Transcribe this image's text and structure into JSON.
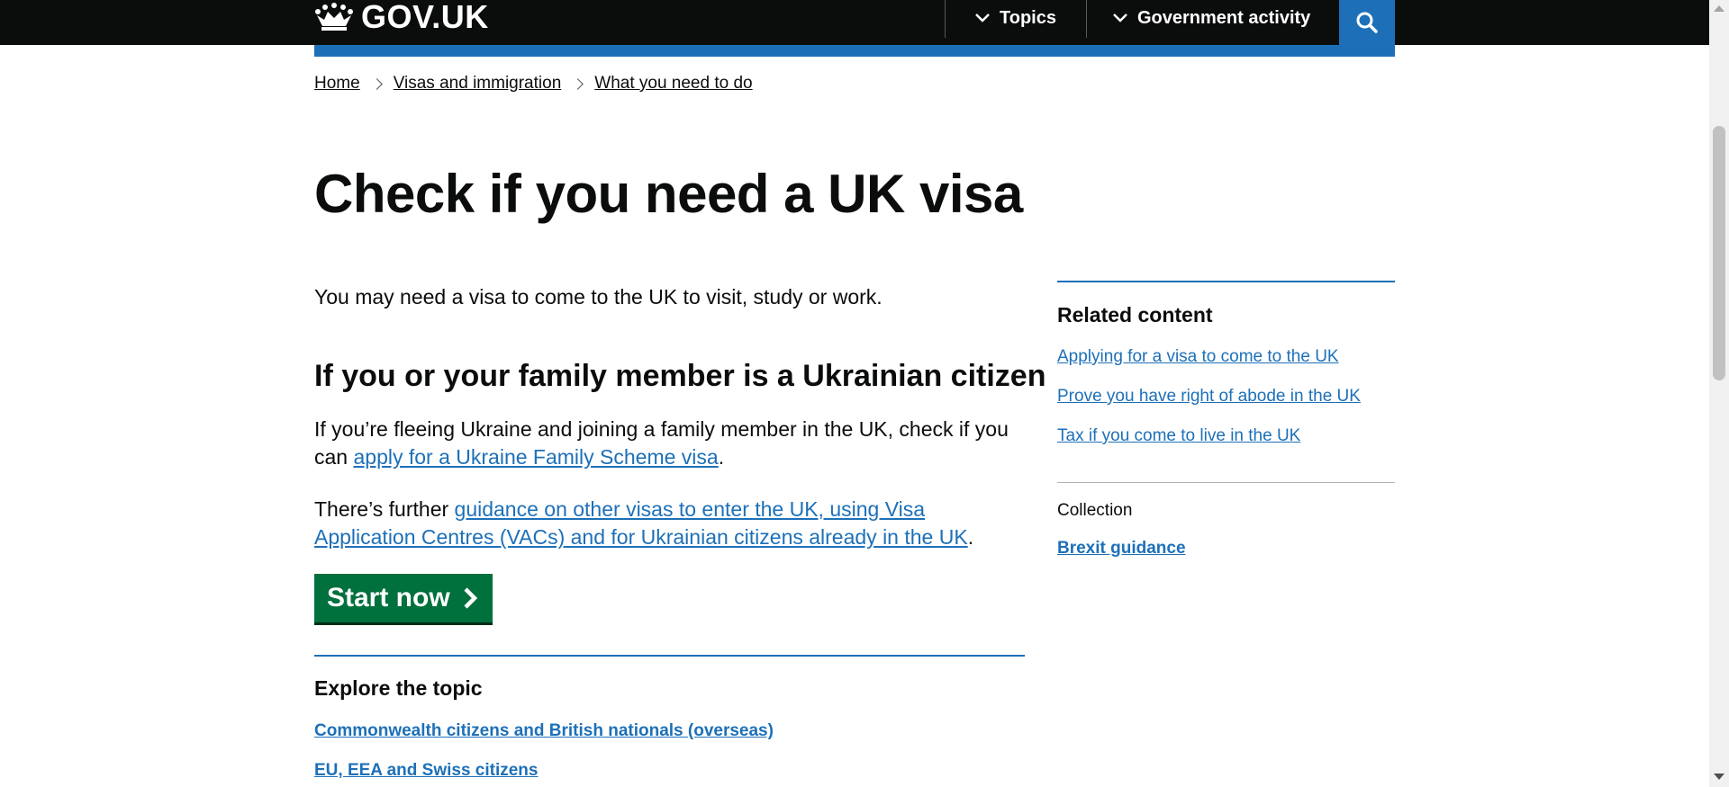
{
  "header": {
    "logo_text": "GOV.UK",
    "logo_icon": "crown-icon",
    "nav": [
      {
        "label": "Topics",
        "icon": "chevron-down-icon"
      },
      {
        "label": "Government activity",
        "icon": "chevron-down-icon"
      }
    ],
    "search_icon": "search-icon",
    "accent_color": "#1d70b8"
  },
  "breadcrumb": [
    "Home",
    "Visas and immigration",
    "What you need to do"
  ],
  "main": {
    "title": "Check if you need a UK visa",
    "lead": "You may need a visa to come to the UK to visit, study or work.",
    "ukraine_heading": "If you or your family member is a Ukrainian citizen",
    "para1_text": "If you’re fleeing Ukraine and joining a family member in the UK, check if you can ",
    "para1_link": "apply for a Ukraine Family Scheme visa",
    "para1_end": ".",
    "para2_text": "There’s further ",
    "para2_link": "guidance on other visas to enter the UK, using Visa Application Centres (VACs) and for Ukrainian citizens already in the UK",
    "para2_end": ".",
    "start_button": "Start now",
    "start_button_color": "#00703c",
    "explore_title": "Explore the topic",
    "explore_links": [
      "Commonwealth citizens and British nationals (overseas)",
      "EU, EEA and Swiss citizens"
    ]
  },
  "sidebar": {
    "title": "Related content",
    "links": [
      "Applying for a visa to come to the UK",
      "Prove you have right of abode in the UK",
      "Tax if you come to live in the UK"
    ],
    "collection_label": "Collection",
    "collection_link": "Brexit guidance"
  }
}
